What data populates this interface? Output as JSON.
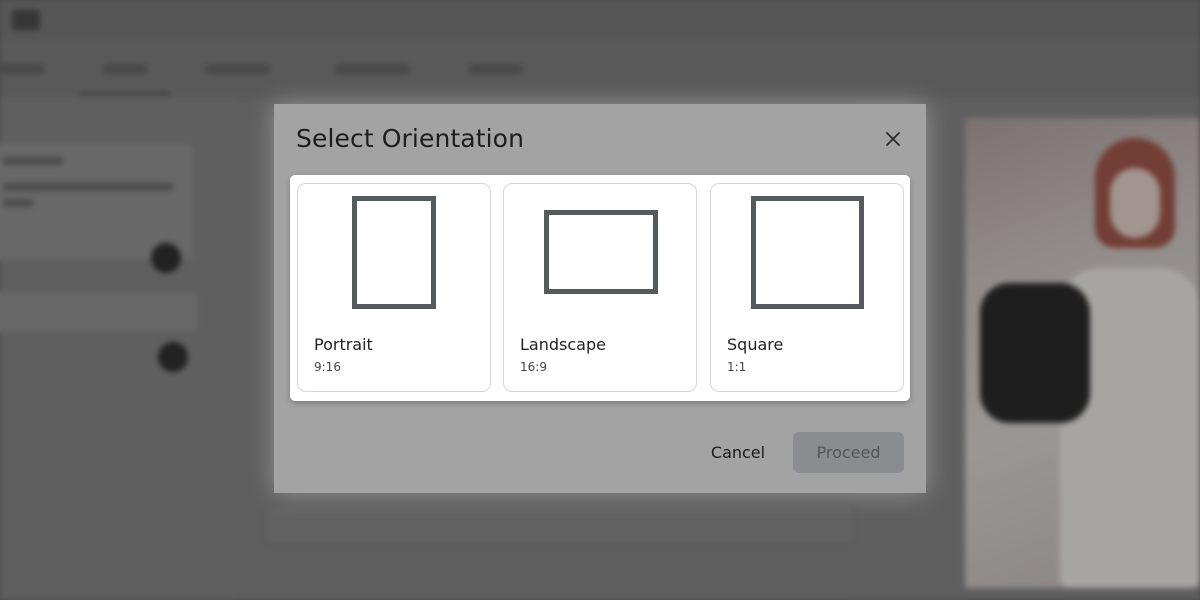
{
  "dialog": {
    "title": "Select Orientation",
    "close_icon": "close-icon",
    "options": [
      {
        "label": "Portrait",
        "ratio": "9:16",
        "icon": "portrait-frame-icon"
      },
      {
        "label": "Landscape",
        "ratio": "16:9",
        "icon": "landscape-frame-icon"
      },
      {
        "label": "Square",
        "ratio": "1:1",
        "icon": "square-frame-icon"
      }
    ],
    "cancel_label": "Cancel",
    "proceed_label": "Proceed",
    "proceed_enabled": false
  },
  "colors": {
    "frame_stroke": "#555a5e",
    "proceed_disabled_bg": "#8b8c8f",
    "panel_bg": "#ffffff"
  }
}
